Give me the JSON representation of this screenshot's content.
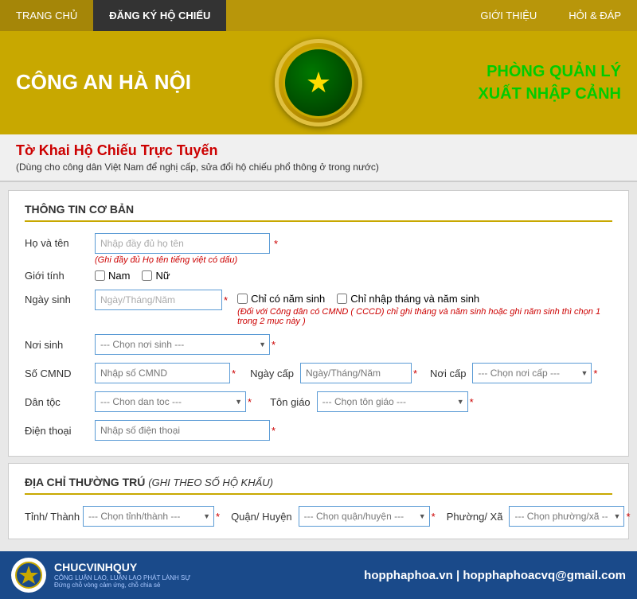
{
  "nav": {
    "items": [
      {
        "id": "trang-chu",
        "label": "TRANG CHỦ",
        "active": false
      },
      {
        "id": "dang-ky",
        "label": "ĐĂNG KÝ HỘ CHIẾU",
        "active": true
      },
      {
        "id": "gioi-thieu",
        "label": "GIỚI THIỆU",
        "active": false
      },
      {
        "id": "hoi-dap",
        "label": "HỎI & ĐÁP",
        "active": false
      }
    ]
  },
  "header": {
    "left_title": "CÔNG AN HÀ NỘI",
    "right_title": "PHÒNG QUẢN LÝ\nXUẤT NHẬP CẢNH"
  },
  "sub_header": {
    "title": "Tờ Khai Hộ Chiếu Trực Tuyến",
    "subtitle": "(Dùng cho công dân Việt Nam để nghị cấp, sửa đổi hộ chiếu phổ thông ở trong nước)"
  },
  "sections": {
    "basic_info": {
      "title": "THÔNG TIN CƠ BẢN",
      "fields": {
        "ho_ten": {
          "label": "Họ và tên",
          "placeholder": "Nhập đầy đủ họ tên",
          "error": "(Ghi đầy đủ Họ tên tiếng việt có dấu)"
        },
        "gioi_tinh": {
          "label": "Giới tính",
          "nam": "Nam",
          "nu": "Nữ"
        },
        "ngay_sinh": {
          "label": "Ngày sinh",
          "placeholder": "Ngày/Tháng/Năm",
          "chi_co_nam_sinh": "Chỉ có năm sinh",
          "chi_nhap_thang": "Chỉ nhập tháng và năm sinh",
          "note": "(Đối với Công dân có CMND ( CCCD) chỉ ghi tháng và năm sinh hoặc ghi năm sinh thì chọn 1 trong 2 mục này )"
        },
        "noi_sinh": {
          "label": "Nơi sinh",
          "placeholder": "--- Chọn nơi sinh ---"
        },
        "so_cmnd": {
          "label": "Số CMND",
          "placeholder": "Nhập số CMND",
          "ngay_cap_label": "Ngày cấp",
          "ngay_cap_placeholder": "Ngày/Tháng/Năm",
          "noi_cap_label": "Nơi cấp",
          "noi_cap_placeholder": "--- Chọn nơi cấp ---"
        },
        "dan_toc": {
          "label": "Dân tộc",
          "placeholder": "--- Chon dan toc ---",
          "ton_giao_label": "Tôn giáo",
          "ton_giao_placeholder": "--- Chọn tôn giáo ---"
        },
        "dien_thoai": {
          "label": "Điện thoại",
          "placeholder": "Nhập số điện thoại"
        }
      }
    },
    "address": {
      "title": "ĐỊA CHỈ THƯỜNG TRÚ",
      "title_italic": "(ghi theo số Hộ Khẩu)",
      "tinh_label": "Tỉnh/ Thành",
      "tinh_placeholder": "--- Chọn tỉnh/thành ---",
      "quan_label": "Quận/ Huyện",
      "quan_placeholder": "--- Chọn quận/huyện ---",
      "phuong_label": "Phường/ Xã",
      "phuong_placeholder": "--- Chọn phường/xã ---"
    }
  },
  "footer": {
    "brand": "CHUCVINHQUY",
    "sub_brand": "CÔNG LUẬN LẠO, LUẬN LẠO PHÁT LÀNH SỰ",
    "tagline": "Đứng chỗ vòng cảm ứng, chỗ chia sẻ",
    "contact": "hopphaphoa.vn | hopphaphoacvq@gmail.com"
  },
  "colors": {
    "gold": "#c8a800",
    "red": "#cc0000",
    "blue": "#1a4a8a",
    "input_border": "#5b9bd5",
    "green_text": "#00aa00"
  }
}
